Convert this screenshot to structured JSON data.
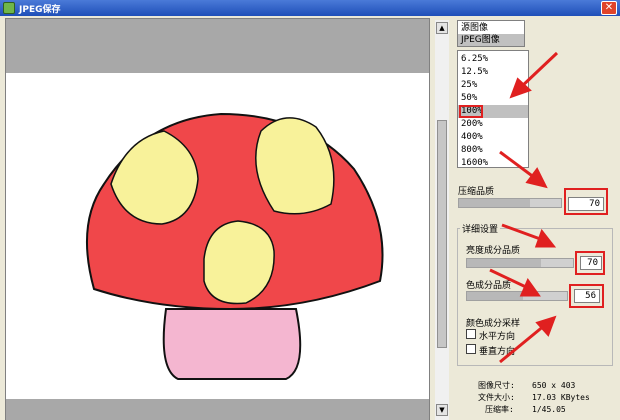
{
  "window": {
    "title": "JPEG保存",
    "close_glyph": "✕"
  },
  "image_selector": {
    "items": [
      "源图像",
      "JPEG图像"
    ],
    "selected_index": 1
  },
  "zoom_list": {
    "items": [
      "6.25%",
      "12.5%",
      "25%",
      "50%",
      "100%",
      "200%",
      "400%",
      "800%",
      "1600%"
    ],
    "selected": "100%"
  },
  "compression": {
    "label": "压缩品质",
    "value": "70",
    "level": 0.7
  },
  "detail": {
    "title": "详细设置",
    "luma_label": "亮度成分品质",
    "luma_value": "70",
    "luma_level": 0.7,
    "chroma_label": "色成分品质",
    "chroma_value": "56",
    "chroma_level": 0.56,
    "sampling_title": "颜色成分采样",
    "horizontal_label": "水平方向",
    "vertical_label": "垂直方向"
  },
  "info": {
    "size_label": "图像尺寸:",
    "size_value": "650 x 403",
    "filesize_label": "文件大小:",
    "filesize_value": "17.03 KBytes",
    "ratio_label": "压缩率:",
    "ratio_value": "1/45.05"
  },
  "icons": {
    "scroll_up": "▲",
    "scroll_down": "▼"
  },
  "colors": {
    "cap_red": "#f0474a",
    "spot_yellow": "#f8f29a",
    "stem_pink": "#f4b6d0",
    "outline": "#111111",
    "annotation_red": "#e02020",
    "titlebar_blue": "#2a5bc8"
  }
}
